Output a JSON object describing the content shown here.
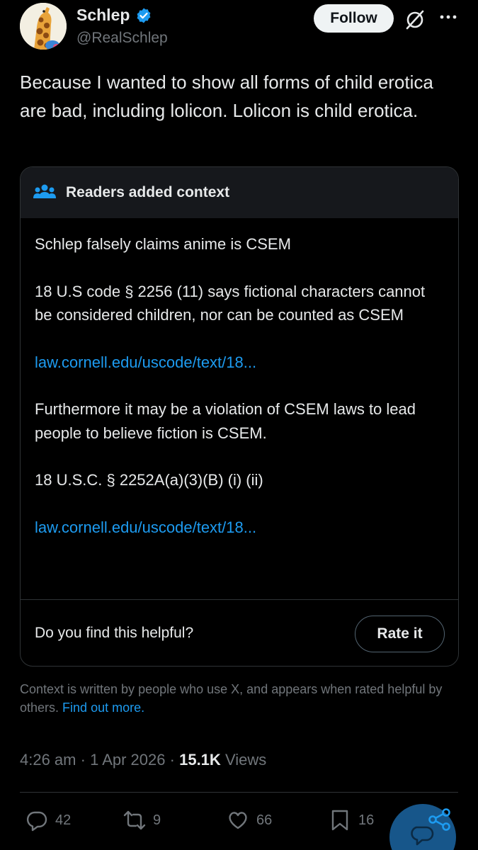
{
  "author": {
    "display_name": "Schlep",
    "handle": "@RealSchlep",
    "verified": true,
    "avatar": "giraffe-avatar"
  },
  "header": {
    "follow_label": "Follow",
    "grok_icon": "grok-icon",
    "more_icon": "more-icon"
  },
  "tweet": {
    "text": "Because I wanted to show all forms of child erotica are bad, including lolicon. Lolicon is child erotica."
  },
  "note": {
    "header_title": "Readers added context",
    "header_icon": "people-icon",
    "paragraphs": [
      "Schlep falsely claims anime is CSEM",
      "18 U.S code § 2256 (11) says fictional characters cannot be considered children, nor can be counted as CSEM"
    ],
    "link1": "law.cornell.edu/uscode/text/18...",
    "paragraph3": "Furthermore it may be a violation of CSEM laws to lead people to believe fiction is CSEM.",
    "paragraph4": "18 U.S.C. § 2252A(a)(3)(B) (i) (ii)",
    "link2": "law.cornell.edu/uscode/text/18...",
    "helpful_question": "Do you find this helpful?",
    "rate_label": "Rate it"
  },
  "context_footer": {
    "text": "Context is written by people who use X, and appears when rated helpful by others.",
    "link": "Find out more."
  },
  "meta": {
    "time": "4:26 am",
    "date": "1 Apr 2026",
    "views_count": "15.1K",
    "views_label": "Views"
  },
  "actions": {
    "replies": "42",
    "reposts": "9",
    "likes": "66",
    "bookmarks": "16"
  },
  "colors": {
    "background": "#000000",
    "text": "#e7e9ea",
    "muted": "#71767b",
    "link": "#1d9bf0",
    "verified": "#1d9bf0"
  }
}
